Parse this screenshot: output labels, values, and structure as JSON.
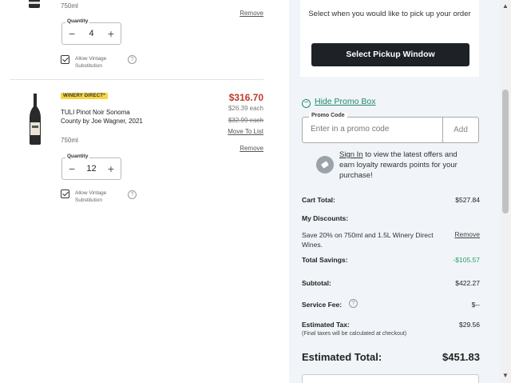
{
  "item1": {
    "volume": "750ml",
    "remove_label": "Remove",
    "quantity_label": "Quantity",
    "quantity": "4",
    "vintage_label": "Allow Vintage Substitution",
    "vintage_checked": true
  },
  "item2": {
    "badge": "WINERY DIRECT*",
    "name": "TULI Pinot Noir Sonoma County by Joe Wagner, 2021",
    "volume": "750ml",
    "price": "$316.70",
    "each_price": "$26.39 each",
    "original_each": "$32.99 each",
    "move_label": "Move To List",
    "remove_label": "Remove",
    "quantity_label": "Quantity",
    "quantity": "12",
    "vintage_label": "Allow Vintage Substitution",
    "vintage_checked": true
  },
  "pickup": {
    "prompt": "Select when you would like to pick up your order",
    "button": "Select Pickup Window"
  },
  "promo": {
    "toggle_label": "Hide Promo Box",
    "field_label": "Promo Code",
    "placeholder": "Enter in a promo code",
    "apply_label": "Add",
    "signin_link": "Sign In",
    "signin_text": " to view the latest offers and earn loyalty rewards points for your purchase!"
  },
  "summary": {
    "cart_total_label": "Cart Total:",
    "cart_total": "$527.84",
    "discounts_label": "My Discounts:",
    "discount_desc": "Save 20% on 750ml and 1.5L Winery Direct Wines.",
    "discount_remove": "Remove",
    "savings_label": "Total Savings:",
    "savings": "-$105.57",
    "subtotal_label": "Subtotal:",
    "subtotal": "$422.27",
    "fee_label": "Service Fee:",
    "fee": "$--",
    "tax_label": "Estimated Tax:",
    "tax": "$29.56",
    "tax_note": "(Final taxes will be calculated at checkout)",
    "total_label": "Estimated Total:",
    "total": "$451.83"
  },
  "colors": {
    "accent_green": "#2e9d6b",
    "price_red": "#c0392b",
    "button_dark": "#1e2227",
    "badge_yellow": "#f5d542"
  }
}
